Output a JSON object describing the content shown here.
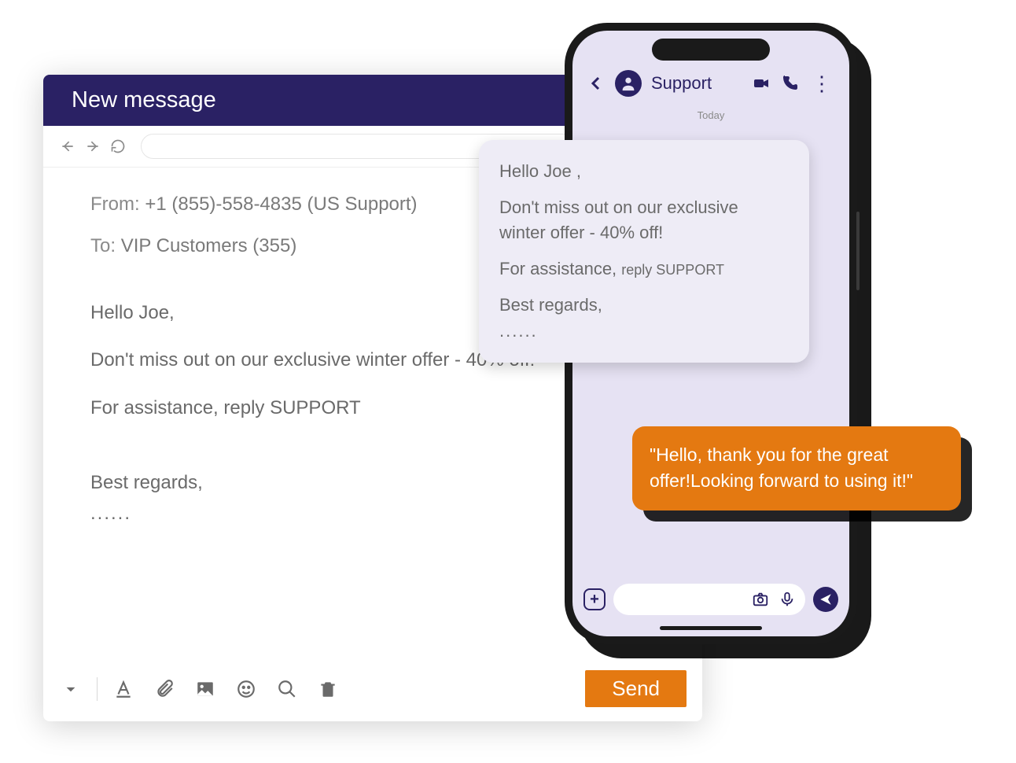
{
  "compose": {
    "title": "New message",
    "from_label": "From:",
    "from_value": "+1 (855)-558-4835 (US Support)",
    "to_label": "To:",
    "to_value": "VIP Customers (355)",
    "body": {
      "greeting": "Hello Joe,",
      "line1": "Don't miss out on our exclusive winter offer - 40% off!",
      "line2": "For assistance, reply SUPPORT",
      "closing": "Best regards,",
      "dots": "......"
    },
    "send_label": "Send"
  },
  "phone": {
    "contact_name": "Support",
    "today_label": "Today",
    "incoming": {
      "greeting": "Hello Joe ,",
      "line1": "Don't miss out on our exclusive winter offer - 40% off!",
      "line2a": "For assistance, ",
      "line2b": "reply SUPPORT",
      "closing": "Best regards,",
      "dots": "......"
    },
    "outgoing": "\"Hello, thank you for the great offer!Looking forward to using it!\""
  }
}
